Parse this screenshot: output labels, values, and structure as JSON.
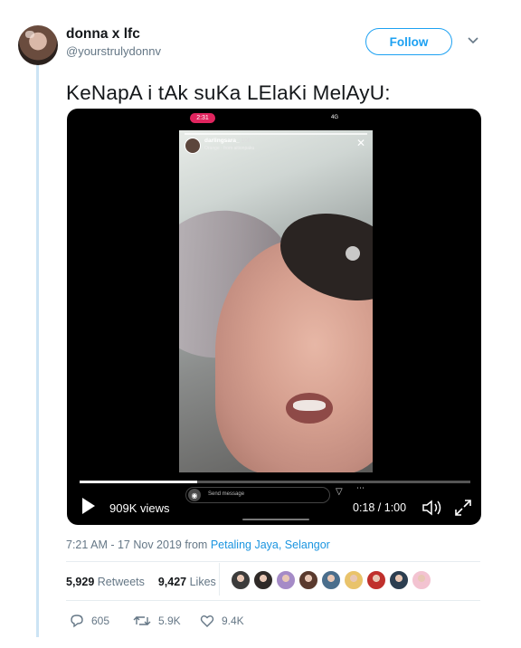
{
  "tweet": {
    "author": {
      "display_name": "donna x lfc",
      "handle": "@yourstrulydonnv"
    },
    "follow_label": "Follow",
    "text": "KeNapA i tAk suKa LElaKi MelAyU:",
    "video": {
      "views": "909K views",
      "time": "0:18 / 1:00",
      "progress": 0.3,
      "story": {
        "status_time": "2:31",
        "status_signal": "4G",
        "username": "darlingsara_",
        "age": "10h",
        "sub_text": "Orange · from aitionpaku",
        "send_message_placeholder": "Send message"
      }
    },
    "meta": {
      "time": "7:21 AM - 17 Nov 2019 from ",
      "location": "Petaling Jaya, Selangor"
    },
    "stats": {
      "retweets_count": "5,929",
      "retweets_label": "Retweets",
      "likes_count": "9,427",
      "likes_label": "Likes",
      "liker_colors": [
        "#3b3b3b",
        "#2f2a28",
        "#a58bc7",
        "#5a3a2e",
        "#4a6e8c",
        "#e9c36b",
        "#c0302c",
        "#2c3e50",
        "#f3c3d1"
      ]
    },
    "actions": {
      "replies": "605",
      "retweets": "5.9K",
      "likes": "9.4K"
    }
  }
}
